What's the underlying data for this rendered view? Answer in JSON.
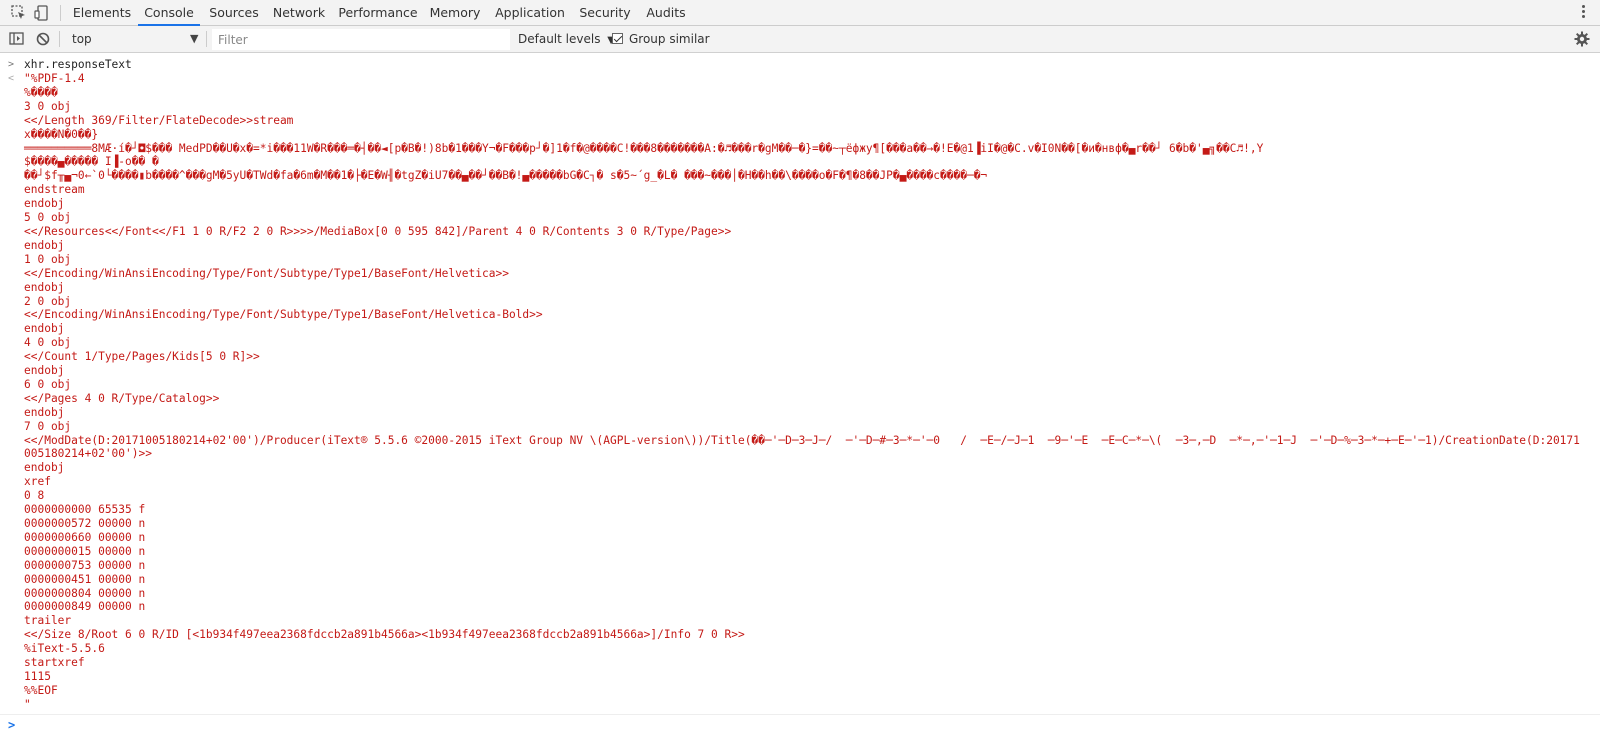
{
  "tabs": [
    {
      "label": "Elements"
    },
    {
      "label": "Console"
    },
    {
      "label": "Sources"
    },
    {
      "label": "Network"
    },
    {
      "label": "Performance"
    },
    {
      "label": "Memory"
    },
    {
      "label": "Application"
    },
    {
      "label": "Security"
    },
    {
      "label": "Audits"
    }
  ],
  "active_tab": "Console",
  "toolbar": {
    "context": "top",
    "filter_placeholder": "Filter",
    "levels_label": "Default levels",
    "group_similar_label": "Group similar",
    "group_similar_checked": true
  },
  "console": {
    "command": "xhr.responseText",
    "result": "\"%PDF-1.4\n%����\n3 0 obj\n<</Length 369/Filter/FlateDecode>>stream\nx����N�0��}\n══════════8MÆ·í�┘◘$��� MedPD��U�x�=*i���11W�R���═�┤��◄[p�B�!)8b�1���Y¬�F���p┘�]1�f�@����C!���8�������A:�♬���r�gM��─�}=��~┬ёфжу¶[���a��→�!E�@1▐iI�@�C.v�I0N��[�и�нвф�▄r��┘ 6�b�'▄╗��C♬!,Y\n$����▄����� I▐-o�� �\n��┘$f╥▄¬0←`0└����▮b����^���gM�5yU�TWd�fa�6m�M��1�├�E�W╢�tgZ�iU7��▄��┘��B�!▄�����bG�C┐� s�5~´g_�L� ���~���│�H��h��\\����o�F�¶�8��JP�▄����c����─�¬\nendstream\nendobj\n5 0 obj\n<</Resources<</Font<</F1 1 0 R/F2 2 0 R>>>>/MediaBox[0 0 595 842]/Parent 4 0 R/Contents 3 0 R/Type/Page>>\nendobj\n1 0 obj\n<</Encoding/WinAnsiEncoding/Type/Font/Subtype/Type1/BaseFont/Helvetica>>\nendobj\n2 0 obj\n<</Encoding/WinAnsiEncoding/Type/Font/Subtype/Type1/BaseFont/Helvetica-Bold>>\nendobj\n4 0 obj\n<</Count 1/Type/Pages/Kids[5 0 R]>>\nendobj\n6 0 obj\n<</Pages 4 0 R/Type/Catalog>>\nendobj\n7 0 obj\n<</ModDate(D:20171005180214+02'00')/Producer(iText® 5.5.6 ©2000-2015 iText Group NV \\(AGPL-version\\))/Title(��─'─D─3─J─/  ─'─D─#─3─*─'─0   /  ─E─/─J─1  ─9─'─E  ─E─C─*─\\(  ─3─,─D  ─*─,─'─1─J  ─'─D─%─3─*─+─E─'─1)/CreationDate(D:20171005180214+02'00')>>\nendobj\nxref\n0 8\n0000000000 65535 f\n0000000572 00000 n\n0000000660 00000 n\n0000000015 00000 n\n0000000753 00000 n\n0000000451 00000 n\n0000000804 00000 n\n0000000849 00000 n\ntrailer\n<</Size 8/Root 6 0 R/ID [<1b934f497eea2368fdccb2a891b4566a><1b934f497eea2368fdccb2a891b4566a>]/Info 7 0 R>>\n%iText-5.5.6\nstartxref\n1115\n%%EOF\n\""
  },
  "icons": {
    "inspect": "inspect-element-icon",
    "device": "device-toolbar-icon",
    "menu": "more-vertical-icon",
    "sidebar": "console-sidebar-icon",
    "clear": "clear-console-icon",
    "dropdown": "chevron-down-icon",
    "settings": "gear-icon"
  },
  "colors": {
    "accent": "#1a73e8",
    "string_value": "#c41a16",
    "toolbar_bg": "#f3f3f3"
  }
}
